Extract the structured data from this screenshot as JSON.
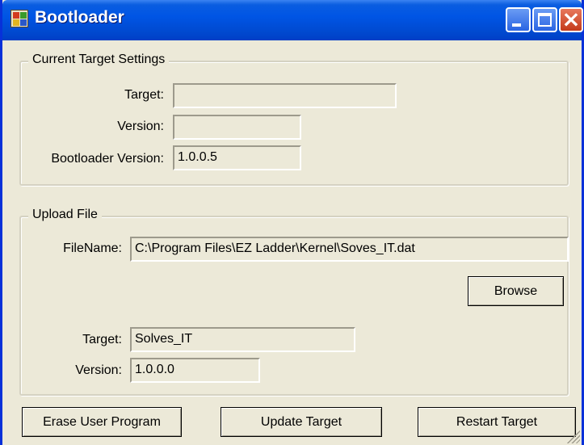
{
  "window": {
    "title": "Bootloader"
  },
  "current_target_settings": {
    "legend": "Current Target Settings",
    "target_label": "Target:",
    "target_value": "",
    "version_label": "Version:",
    "version_value": "",
    "bootloader_version_label": "Bootloader Version:",
    "bootloader_version_value": "1.0.0.5"
  },
  "upload_file": {
    "legend": "Upload File",
    "filename_label": "FileName:",
    "filename_value": "C:\\Program Files\\EZ Ladder\\Kernel\\Soves_IT.dat",
    "browse_label": "Browse",
    "target_label": "Target:",
    "target_value": "Solves_IT",
    "version_label": "Version:",
    "version_value": "1.0.0.0"
  },
  "buttons": {
    "erase_label": "Erase User Program",
    "update_label": "Update Target",
    "restart_label": "Restart Target"
  },
  "icons": {
    "app": "bootloader-app-icon",
    "minimize": "minimize-icon",
    "maximize": "maximize-icon",
    "close": "close-icon"
  }
}
